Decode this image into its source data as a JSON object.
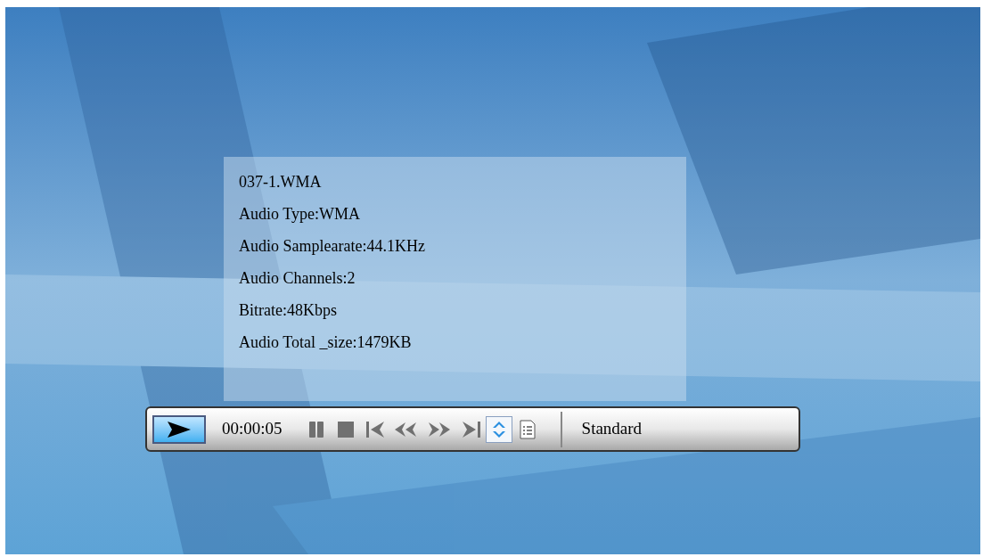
{
  "info_panel": {
    "lines": [
      "037-1.WMA",
      "Audio Type:WMA",
      "Audio Samplearate:44.1KHz",
      "Audio Channels:2",
      "Bitrate:48Kbps",
      "Audio Total _size:1479KB"
    ]
  },
  "control_bar": {
    "play_button": {
      "selected": true
    },
    "time": "00:00:05",
    "buttons": [
      {
        "kind": "pause",
        "selected": false
      },
      {
        "kind": "stop",
        "selected": false
      },
      {
        "kind": "previous",
        "selected": false
      },
      {
        "kind": "rewind",
        "selected": false
      },
      {
        "kind": "forward",
        "selected": false
      },
      {
        "kind": "next",
        "selected": false
      },
      {
        "kind": "repeat",
        "selected": true
      },
      {
        "kind": "playlist",
        "selected": false
      }
    ],
    "mode": "Standard"
  }
}
